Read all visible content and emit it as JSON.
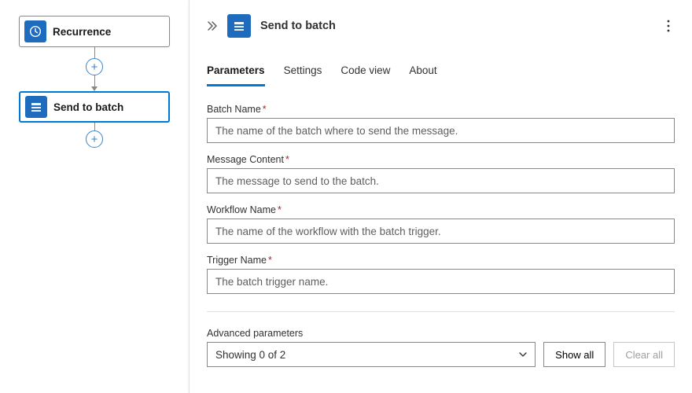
{
  "canvas": {
    "recurrence_label": "Recurrence",
    "send_to_batch_label": "Send to batch"
  },
  "panel": {
    "title": "Send to batch",
    "tabs": {
      "parameters": "Parameters",
      "settings": "Settings",
      "code_view": "Code view",
      "about": "About"
    },
    "fields": {
      "batch_name": {
        "label": "Batch Name",
        "placeholder": "The name of the batch where to send the message."
      },
      "message_content": {
        "label": "Message Content",
        "placeholder": "The message to send to the batch."
      },
      "workflow_name": {
        "label": "Workflow Name",
        "placeholder": "The name of the workflow with the batch trigger."
      },
      "trigger_name": {
        "label": "Trigger Name",
        "placeholder": "The batch trigger name."
      }
    },
    "advanced": {
      "label": "Advanced parameters",
      "combo_text": "Showing 0 of 2",
      "show_all": "Show all",
      "clear_all": "Clear all"
    }
  }
}
